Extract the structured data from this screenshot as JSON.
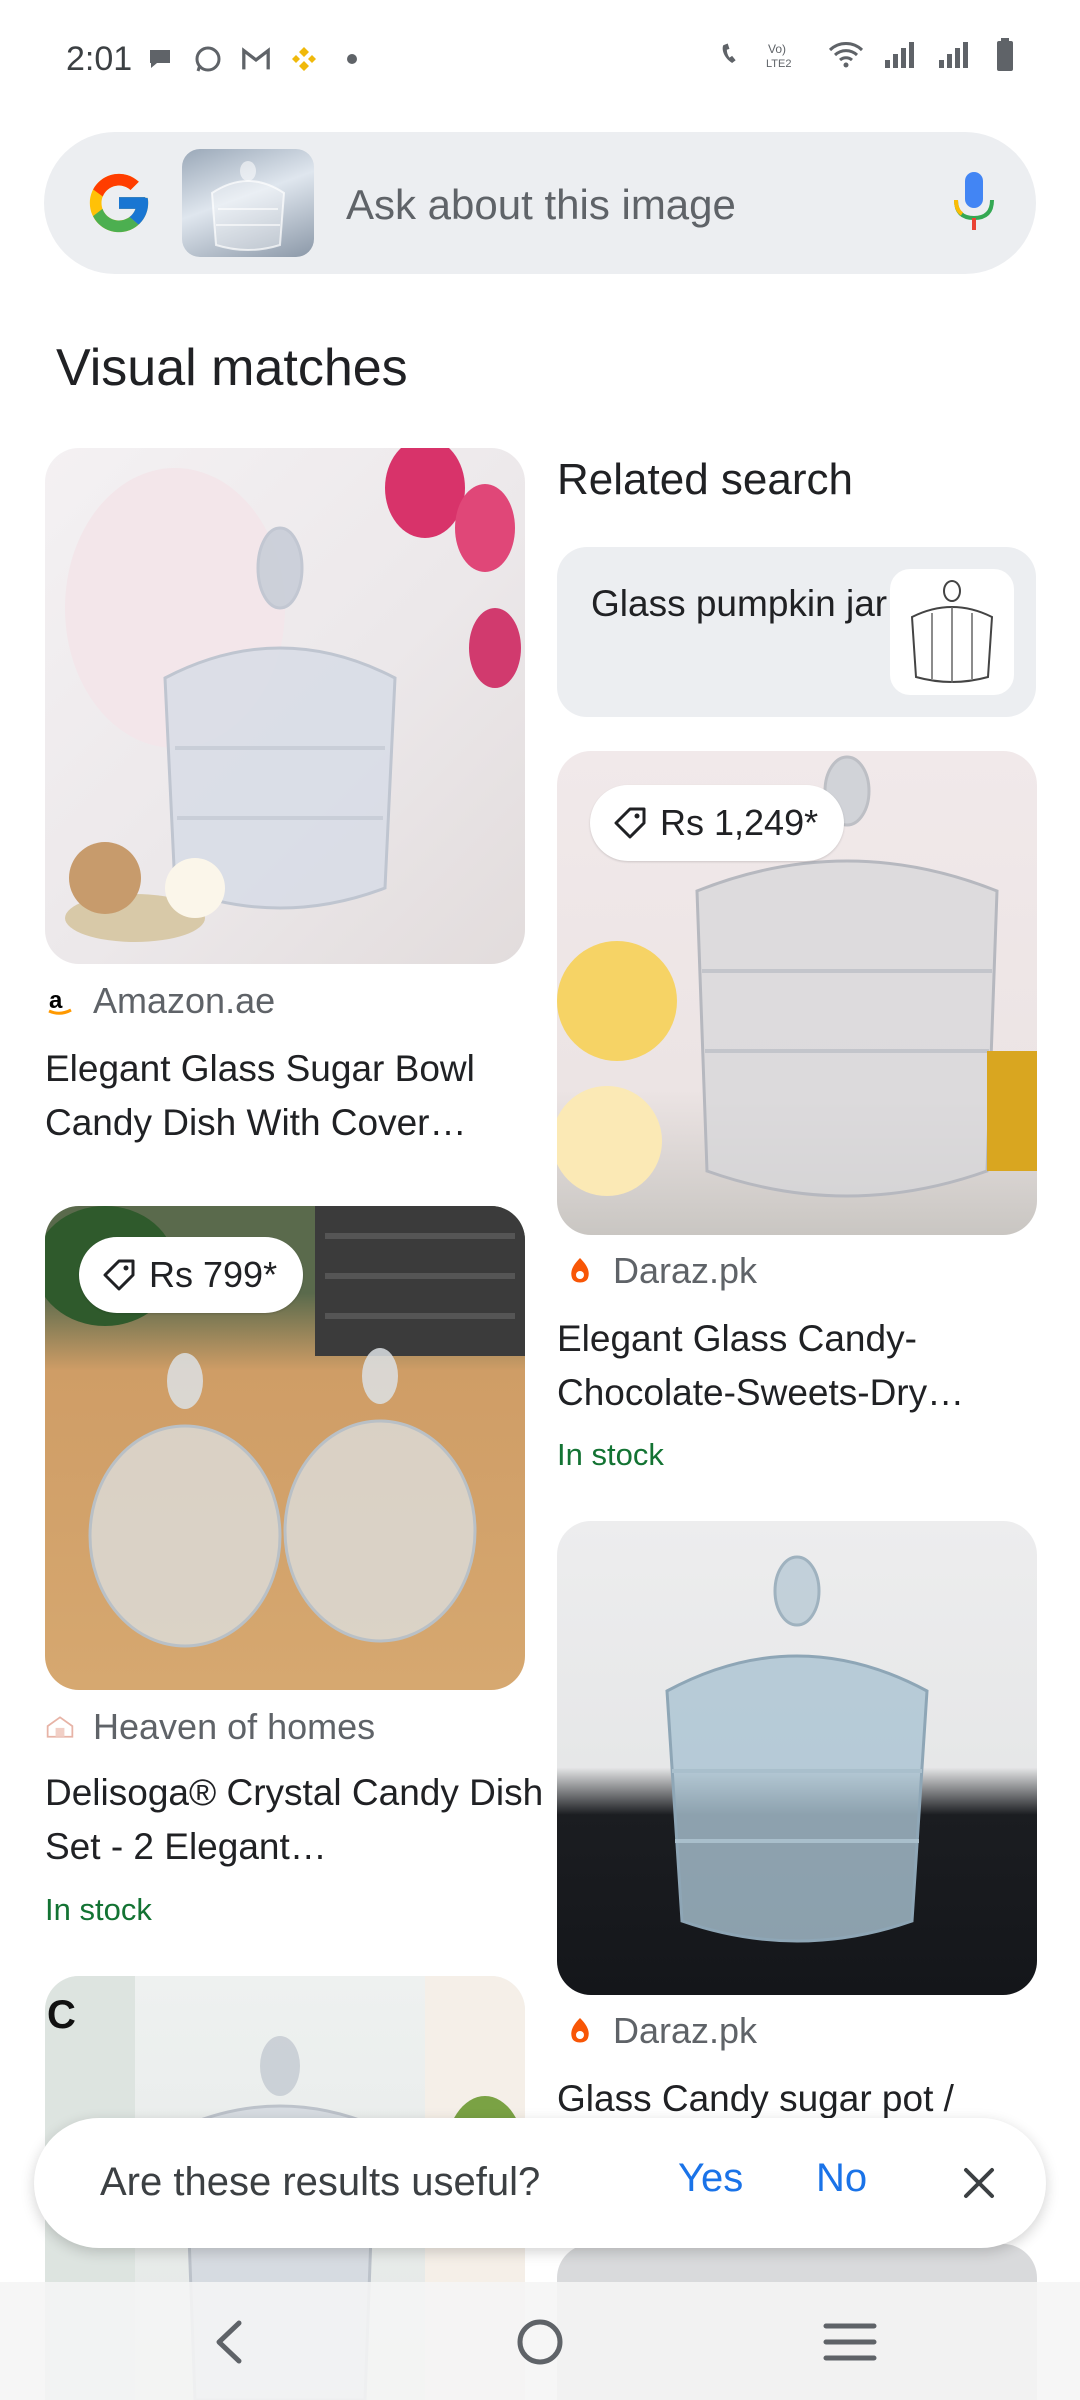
{
  "status_bar": {
    "time": "2:01",
    "left_icons": [
      "chat-bubble-icon",
      "whatsapp-icon",
      "gmail-icon",
      "binance-icon",
      "dot-icon"
    ],
    "right_icons": [
      "wifi-call-icon",
      "volte-icon",
      "wifi-icon",
      "signal-icon",
      "signal-icon",
      "battery-icon"
    ],
    "volte_text": "Vo) LTE2"
  },
  "search": {
    "placeholder": "Ask about this image"
  },
  "section_title": "Visual matches",
  "related": {
    "title": "Related search",
    "chip_label": "Glass pumpkin jar"
  },
  "results": [
    {
      "source": "Amazon.ae",
      "source_icon": "amazon-icon",
      "title": "Elegant Glass Sugar Bowl Candy Dish With Cover…",
      "price": "",
      "stock": ""
    },
    {
      "source": "Daraz.pk",
      "source_icon": "daraz-icon",
      "title": "Elegant Glass Candy-Chocolate-Sweets-Dry…",
      "price": "Rs 1,249*",
      "stock": "In stock"
    },
    {
      "source": "Heaven of homes",
      "source_icon": "heaven-of-homes-icon",
      "title": "Delisoga® Crystal Candy Dish Set - 2 Elegant…",
      "price": "Rs 799*",
      "stock": "In stock"
    },
    {
      "source": "Daraz.pk",
      "source_icon": "daraz-icon",
      "title": "Glass Candy sugar pot /",
      "price": "",
      "stock": ""
    }
  ],
  "feedback": {
    "question": "Are these results useful?",
    "yes": "Yes",
    "no": "No"
  },
  "colors": {
    "link_blue": "#1a73e8",
    "stock_green": "#137333",
    "pill_bg": "#eceef1"
  }
}
